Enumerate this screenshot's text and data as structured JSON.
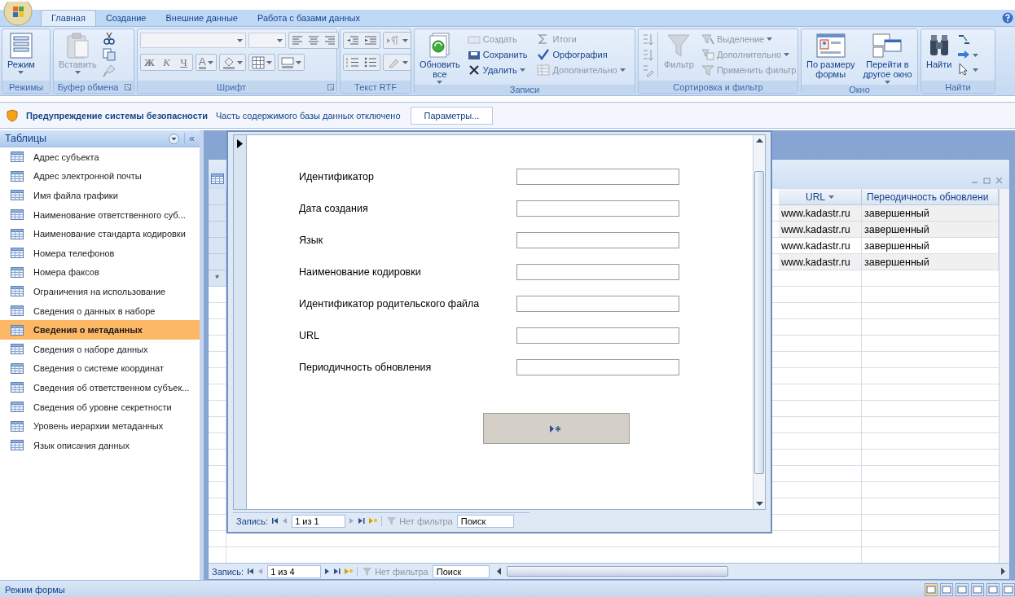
{
  "ribbon": {
    "tabs": [
      {
        "label": "Главная",
        "selected": true
      },
      {
        "label": "Создание",
        "selected": false
      },
      {
        "label": "Внешние данные",
        "selected": false
      },
      {
        "label": "Работа с базами данных",
        "selected": false
      }
    ],
    "groups": [
      {
        "kind": "views",
        "label": "Режимы",
        "launcher": false,
        "large": [
          {
            "label": "Режим",
            "disabled": false,
            "dropdown": true
          }
        ]
      },
      {
        "kind": "clipboard",
        "label": "Буфер обмена",
        "launcher": true,
        "large": [
          {
            "label": "Вставить",
            "disabled": true,
            "dropdown": true
          }
        ]
      },
      {
        "kind": "font",
        "label": "Шрифт",
        "launcher": true,
        "format": [
          "Ж",
          "К",
          "Ч"
        ],
        "color_letter": "А"
      },
      {
        "kind": "rtf",
        "label": "Текст RTF",
        "launcher": false
      },
      {
        "kind": "records",
        "label": "Записи",
        "launcher": false,
        "large": [
          {
            "label": "Обновить\nвсе",
            "disabled": false,
            "dropdown": true
          }
        ],
        "small": [
          {
            "label": "Создать",
            "disabled": true,
            "dropdown": false
          },
          {
            "label": "Сохранить",
            "disabled": false,
            "dropdown": false
          },
          {
            "label": "Удалить",
            "disabled": false,
            "dropdown": true
          },
          {
            "label": "Итоги",
            "disabled": true,
            "dropdown": false
          },
          {
            "label": "Орфография",
            "disabled": false,
            "dropdown": false
          },
          {
            "label": "Дополнительно",
            "disabled": true,
            "dropdown": true
          }
        ]
      },
      {
        "kind": "sort",
        "label": "Сортировка и фильтр",
        "launcher": false,
        "large": [
          {
            "label": "Фильтр",
            "disabled": true,
            "dropdown": false
          }
        ],
        "small": [
          {
            "label": "Выделение",
            "disabled": true,
            "dropdown": true
          },
          {
            "label": "Дополнительно",
            "disabled": true,
            "dropdown": true
          },
          {
            "label": "Применить фильтр",
            "disabled": true,
            "dropdown": false
          }
        ]
      },
      {
        "kind": "window",
        "label": "Окно",
        "launcher": false,
        "large": [
          {
            "label": "По размеру\nформы",
            "disabled": false,
            "dropdown": false
          },
          {
            "label": "Перейти в\nдругое окно",
            "disabled": false,
            "dropdown": true
          }
        ]
      },
      {
        "kind": "find",
        "label": "Найти",
        "launcher": false,
        "large": [
          {
            "label": "Найти",
            "disabled": false,
            "dropdown": false
          }
        ]
      }
    ]
  },
  "security_bar": {
    "title": "Предупреждение системы безопасности",
    "message": "Часть содержимого базы данных отключено",
    "button": "Параметры..."
  },
  "nav_pane": {
    "title": "Таблицы",
    "collapse": "«",
    "items": [
      {
        "label": "Адрес субъекта",
        "selected": false
      },
      {
        "label": "Адрес электронной почты",
        "selected": false
      },
      {
        "label": "Имя файла графики",
        "selected": false
      },
      {
        "label": "Наименование ответственного суб...",
        "selected": false
      },
      {
        "label": "Наименование стандарта кодировки",
        "selected": false
      },
      {
        "label": "Номера телефонов",
        "selected": false
      },
      {
        "label": "Номера факсов",
        "selected": false
      },
      {
        "label": "Ограничения на использование",
        "selected": false
      },
      {
        "label": "Сведения о данных в наборе",
        "selected": false
      },
      {
        "label": "Сведения о метаданных",
        "selected": true
      },
      {
        "label": "Сведения о наборе данных",
        "selected": false
      },
      {
        "label": "Сведения о системе координат",
        "selected": false
      },
      {
        "label": "Сведения об ответственном субъек...",
        "selected": false
      },
      {
        "label": "Сведения об уровне секретности",
        "selected": false
      },
      {
        "label": "Уровень иерархии метаданных",
        "selected": false
      },
      {
        "label": "Язык описания данных",
        "selected": false
      }
    ]
  },
  "datasheet": {
    "columns": [
      {
        "label": "URL"
      },
      {
        "label": "Переодичность обновлени"
      }
    ],
    "rows": [
      {
        "cells": [
          "www.kadastr.ru",
          "завершенный"
        ]
      },
      {
        "cells": [
          "www.kadastr.ru",
          "завершенный"
        ]
      },
      {
        "cells": [
          "www.kadastr.ru",
          "завершенный"
        ]
      },
      {
        "cells": [
          "www.kadastr.ru",
          "завершенный"
        ]
      }
    ],
    "new_row_marker": "*",
    "navigation": {
      "label": "Запись:",
      "position": "1 из 4",
      "filter": "Нет фильтра",
      "search": "Поиск"
    }
  },
  "form": {
    "fields": [
      {
        "label": "Идентификатор"
      },
      {
        "label": "Дата создания"
      },
      {
        "label": "Язык"
      },
      {
        "label": "Наименование кодировки"
      },
      {
        "label": "Идентификатор родительского файла"
      },
      {
        "label": "URL"
      },
      {
        "label": "Периодичность обновления"
      }
    ],
    "navigation": {
      "label": "Запись:",
      "position": "1 из 1",
      "filter": "Нет фильтра",
      "search": "Поиск"
    }
  },
  "status_bar": {
    "text": "Режим формы"
  }
}
